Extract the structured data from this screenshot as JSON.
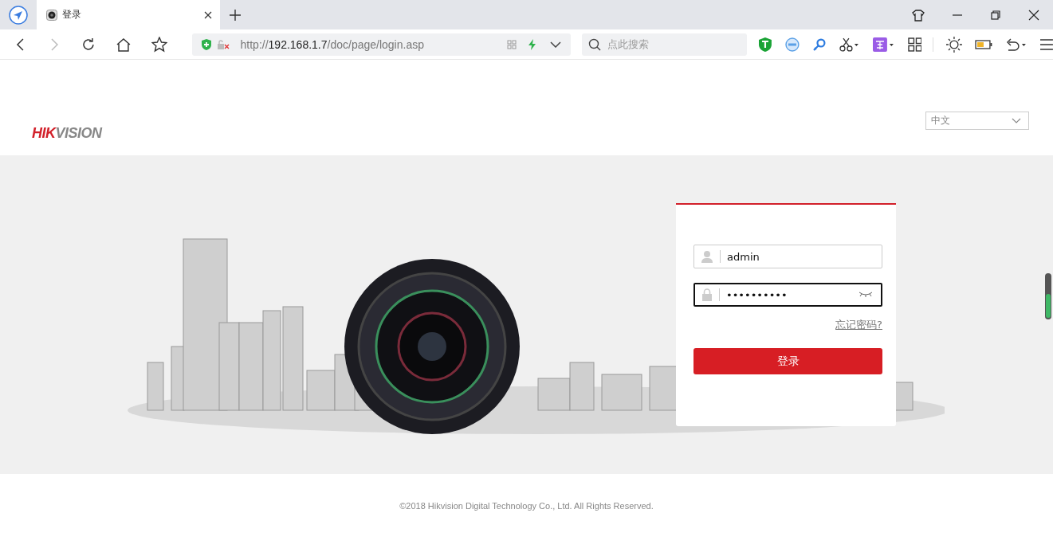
{
  "browser": {
    "tab": {
      "title": "登录",
      "selected": true
    },
    "url": {
      "scheme": "http://",
      "host": "192.168.1.7",
      "path": "/doc/page/login.asp"
    },
    "search": {
      "placeholder": "点此搜索"
    }
  },
  "header": {
    "logo": {
      "part_1": "HIK",
      "part_2": "VISION"
    },
    "language": {
      "value": "中文"
    }
  },
  "login": {
    "username": {
      "value": "admin",
      "focused": false
    },
    "password": {
      "value": "••••••••••",
      "focused": true
    },
    "forgot_link": "忘记密码?",
    "submit": "登录"
  },
  "footer": {
    "copyright": "©2018 Hikvision Digital Technology Co., Ltd. All Rights Reserved."
  }
}
